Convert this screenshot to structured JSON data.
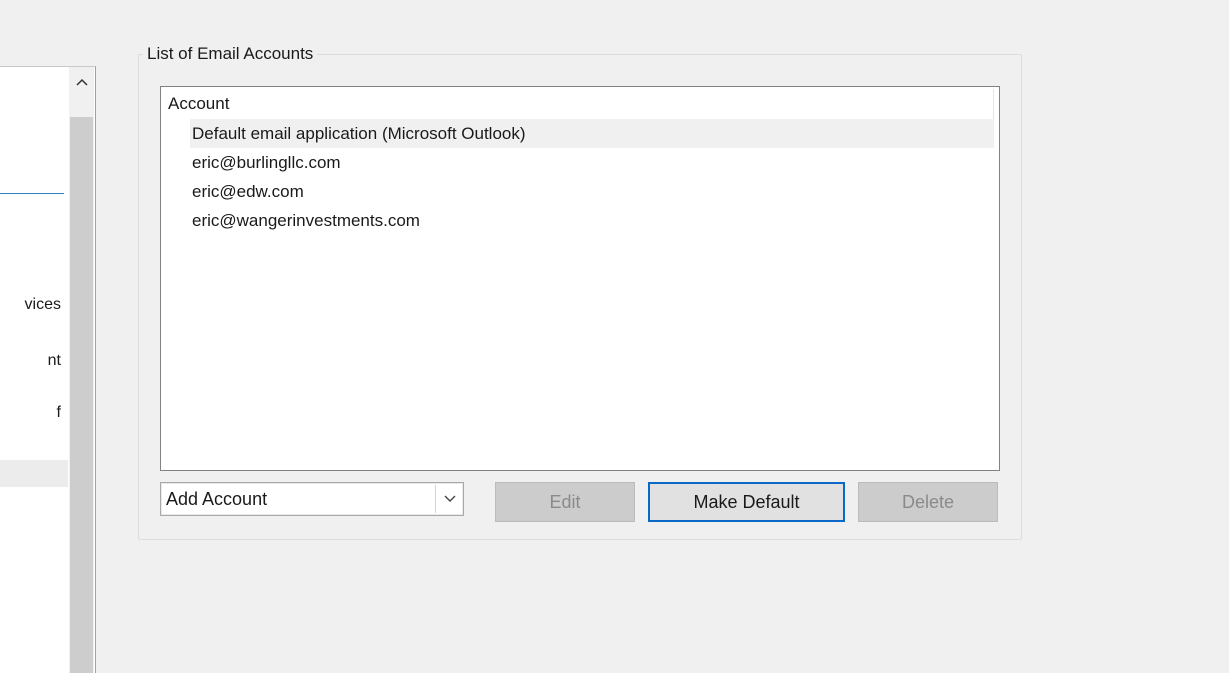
{
  "nav": {
    "items": [
      {
        "label": "vices"
      },
      {
        "label": "nt"
      },
      {
        "label": "f"
      }
    ]
  },
  "group": {
    "title": "List of Email Accounts"
  },
  "list": {
    "header": "Account",
    "rows": [
      {
        "label": "Default email application (Microsoft Outlook)",
        "selected": true
      },
      {
        "label": "eric@burlingllc.com",
        "selected": false
      },
      {
        "label": "eric@edw.com",
        "selected": false
      },
      {
        "label": "eric@wangerinvestments.com",
        "selected": false
      }
    ]
  },
  "controls": {
    "add_account": "Add Account",
    "edit": "Edit",
    "make_default": "Make Default",
    "delete": "Delete"
  },
  "colors": {
    "accent": "#0a68c7",
    "disabled_button": "#cccccc",
    "window_bg": "#f0f0f0"
  },
  "icons": {
    "scroll_up": "chevron-up-icon",
    "dropdown": "chevron-down-icon"
  }
}
